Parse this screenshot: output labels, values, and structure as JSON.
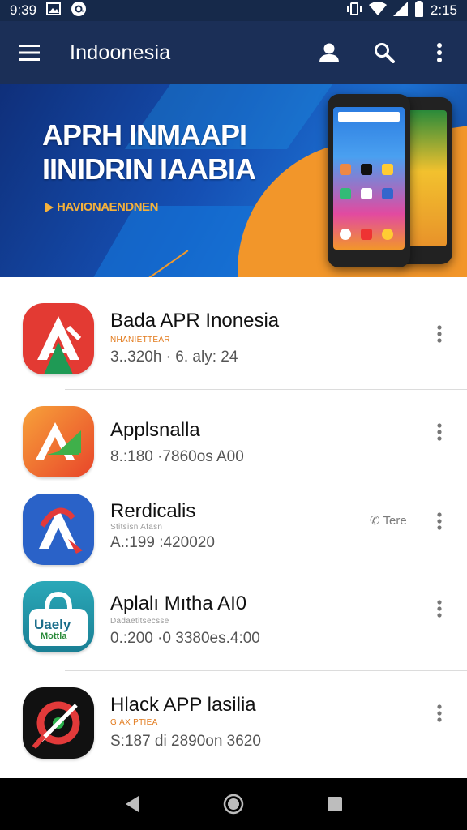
{
  "status_bar": {
    "left_time": "9:39",
    "right_time": "2:15",
    "left_icons": [
      "gallery-icon",
      "at-sign-icon"
    ],
    "right_icons": [
      "vibrate-icon",
      "wifi-icon",
      "signal-icon",
      "battery-icon"
    ]
  },
  "app_bar": {
    "title": "Indoonesia",
    "menu_icon": "hamburger-menu-icon",
    "actions": [
      "account-icon",
      "search-icon",
      "more-vert-icon"
    ]
  },
  "banner": {
    "headline_line1": "APRH INMAAPI",
    "headline_line2": "IINIDRIN IAABIA",
    "subtext": "HAVIONAENDNEN",
    "colors": {
      "blue": "#1550b4",
      "orange": "#f2962a"
    }
  },
  "apps": [
    {
      "title": "Bada APR Inonesia",
      "tag": "NHANIETTEAR",
      "meta": "3..320h · 6. aly: 24",
      "icon": "red-a-icon",
      "tag_style": "orange"
    },
    {
      "title": "Applsnalla",
      "tag": "",
      "meta": "8.:180 ·7860os A00",
      "icon": "orange-a-icon",
      "tag_style": ""
    },
    {
      "title": "Rerdicalis",
      "tag": "Stitsisn Afasn",
      "meta": "A.:199 :420020",
      "icon": "blue-a-icon",
      "tag_style": "grey",
      "status": "Tere"
    },
    {
      "title": "Aplalı Mıtha AI0",
      "tag": "Dadaetitsecsse",
      "meta": "0.:200 ·0 3380es.4:00",
      "icon": "teal-bag-icon",
      "tag_style": "grey",
      "icon_label_top": "Uaely",
      "icon_label_bottom": "Mottla"
    },
    {
      "title": "Hlack APP lasilia",
      "tag": "GIAX PTIEA",
      "meta": "S:187 di 2890on 3620",
      "icon": "black-red-icon",
      "tag_style": "orange"
    }
  ],
  "nav_bar": {
    "buttons": [
      "back-icon",
      "home-icon",
      "recents-icon"
    ]
  }
}
